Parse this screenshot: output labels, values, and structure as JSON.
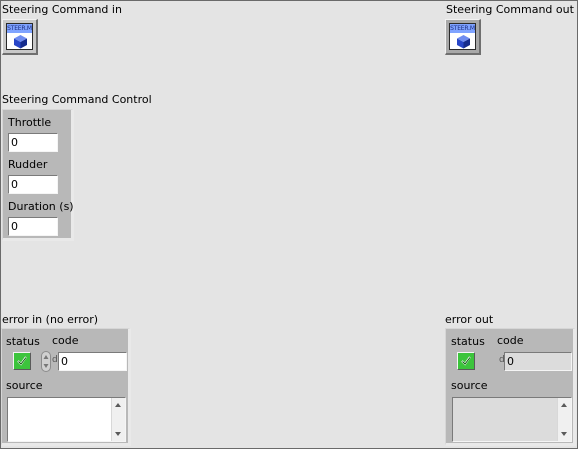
{
  "steering_in": {
    "label": "Steering Command in",
    "icon_text": "STEER.M"
  },
  "steering_out": {
    "label": "Steering Command out",
    "icon_text": "STEER.M"
  },
  "control": {
    "label": "Steering Command Control",
    "throttle_label": "Throttle",
    "throttle_value": "0",
    "rudder_label": "Rudder",
    "rudder_value": "0",
    "duration_label": "Duration (s)",
    "duration_value": "0"
  },
  "error_in": {
    "label": "error in (no error)",
    "status_label": "status",
    "code_label": "code",
    "code_value": "0",
    "source_label": "source",
    "radix": "d"
  },
  "error_out": {
    "label": "error out",
    "status_label": "status",
    "code_label": "code",
    "code_value": "0",
    "source_label": "source",
    "radix": "d"
  },
  "colors": {
    "led_green": "#3cc43c",
    "cube_blue": "#2846c8",
    "refnum_header": "#7fa3ff"
  }
}
